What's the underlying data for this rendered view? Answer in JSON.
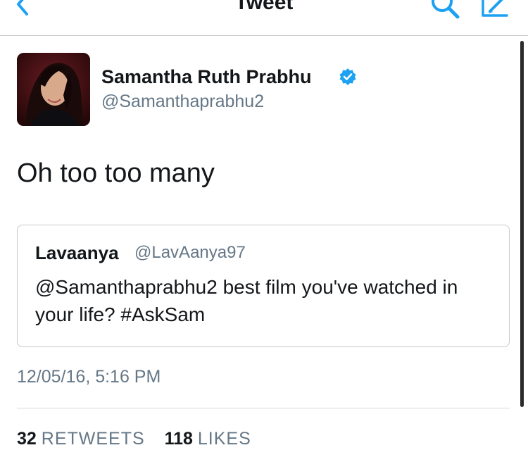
{
  "nav": {
    "title": "Tweet",
    "back_icon": "chevron-left-icon",
    "search_icon": "search-icon",
    "compose_icon": "compose-icon",
    "accent_color": "#1da1f2"
  },
  "tweet": {
    "author": {
      "name": "Samantha Ruth Prabhu",
      "handle": "@Samanthaprabhu2",
      "verified": true
    },
    "text": "Oh too too many",
    "quoted": {
      "name": "Lavaanya",
      "handle": "@LavAanya97",
      "text": "@Samanthaprabhu2 best film you've watched in your life? #AskSam"
    },
    "timestamp": "12/05/16, 5:16 PM",
    "stats": {
      "retweets_count": "32",
      "retweets_label": "RETWEETS",
      "likes_count": "118",
      "likes_label": "LIKES"
    }
  }
}
